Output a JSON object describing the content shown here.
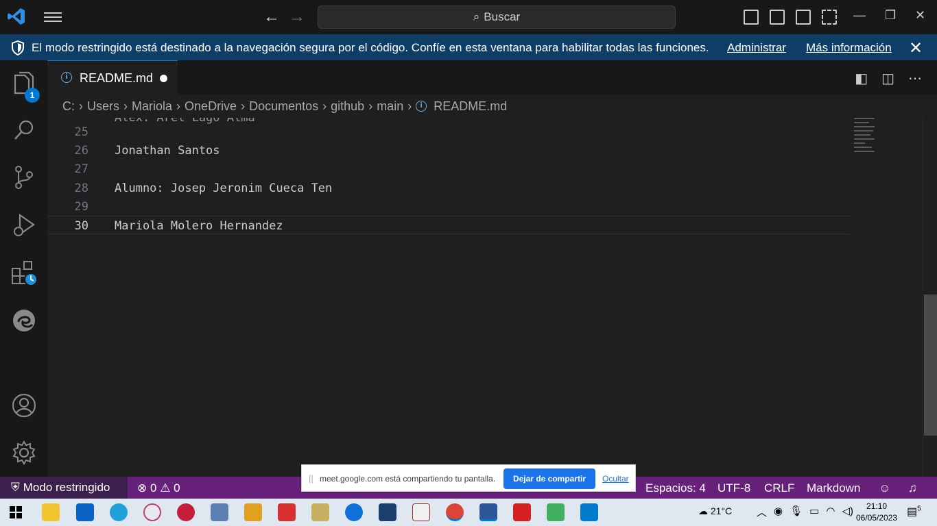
{
  "titlebar": {
    "search_placeholder": "Buscar"
  },
  "banner": {
    "message": "El modo restringido está destinado a la navegación segura por el código. Confíe en esta ventana para habilitar todas las funciones.",
    "manage_link": "Administrar",
    "more_info_link": "Más información"
  },
  "activity_bar": {
    "explorer_badge": "1"
  },
  "tab": {
    "filename": "README.md"
  },
  "breadcrumb": {
    "segments": [
      "C:",
      "Users",
      "Mariola",
      "OneDrive",
      "Documentos",
      "github",
      "main",
      "README.md"
    ]
  },
  "editor": {
    "lines": [
      {
        "number": "25",
        "text": ""
      },
      {
        "number": "26",
        "text": "Jonathan Santos"
      },
      {
        "number": "27",
        "text": ""
      },
      {
        "number": "28",
        "text": "Alumno: Josep Jeronim Cueca Ten"
      },
      {
        "number": "29",
        "text": ""
      },
      {
        "number": "30",
        "text": "Mariola Molero Hernandez"
      }
    ],
    "partial_top_line": "Alex. Arel Lago Alma"
  },
  "statusbar": {
    "restricted": "Modo restringido",
    "errors": "0",
    "warnings": "0",
    "spaces": "Espacios: 4",
    "encoding": "UTF-8",
    "eol": "CRLF",
    "language": "Markdown"
  },
  "share_dialog": {
    "text": "meet.google.com está compartiendo tu pantalla.",
    "stop_button": "Dejar de compartir",
    "hide_link": "Ocultar"
  },
  "taskbar": {
    "temperature": "21°C",
    "time": "21:10",
    "date": "06/05/2023",
    "notification_count": "5"
  },
  "colors": {
    "accent": "#0078d4",
    "statusbar": "#68217a",
    "banner": "#0e3e66"
  }
}
